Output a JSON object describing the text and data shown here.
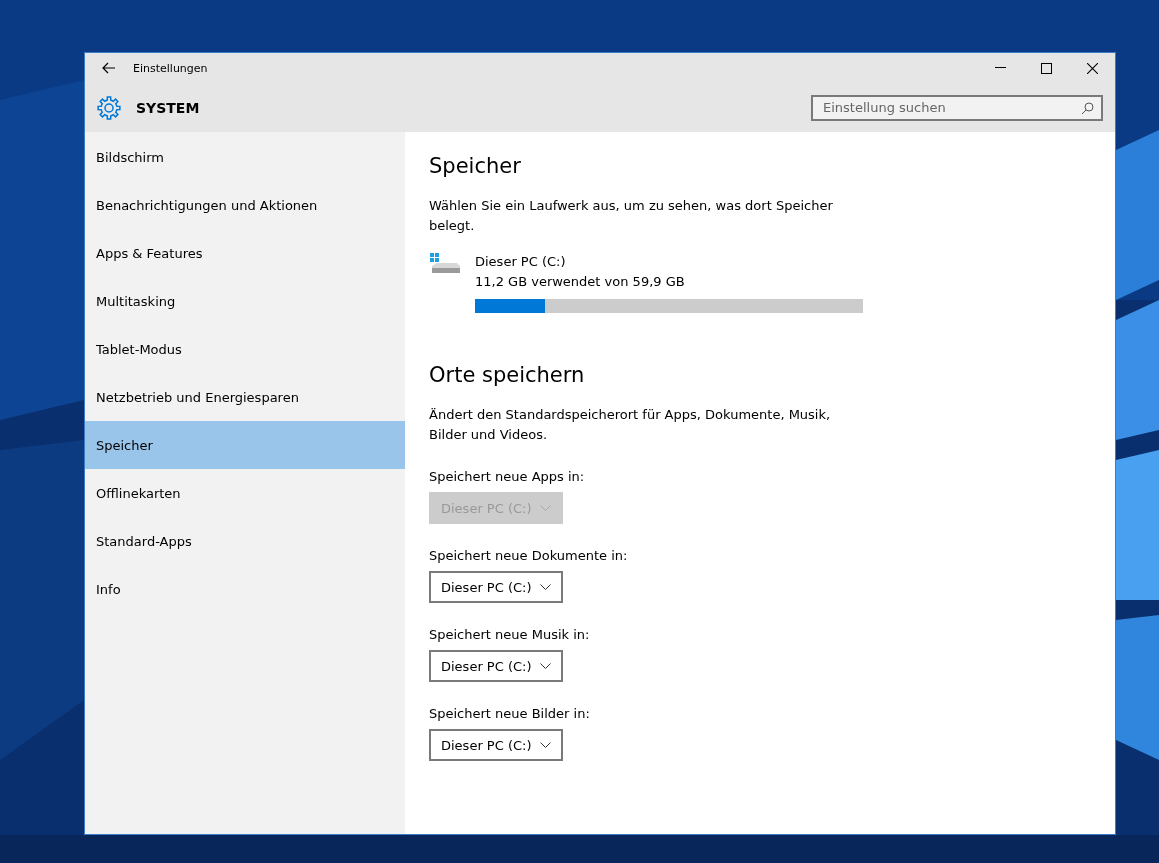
{
  "window": {
    "title": "Einstellungen"
  },
  "header": {
    "title": "SYSTEM",
    "search": {
      "placeholder": "Einstellung suchen"
    }
  },
  "sidebar": {
    "items": [
      {
        "label": "Bildschirm",
        "selected": false
      },
      {
        "label": "Benachrichtigungen und Aktionen",
        "selected": false
      },
      {
        "label": "Apps & Features",
        "selected": false
      },
      {
        "label": "Multitasking",
        "selected": false
      },
      {
        "label": "Tablet-Modus",
        "selected": false
      },
      {
        "label": "Netzbetrieb und Energiesparen",
        "selected": false
      },
      {
        "label": "Speicher",
        "selected": true
      },
      {
        "label": "Offlinekarten",
        "selected": false
      },
      {
        "label": "Standard-Apps",
        "selected": false
      },
      {
        "label": "Info",
        "selected": false
      }
    ]
  },
  "storage": {
    "heading": "Speicher",
    "description": "Wählen Sie ein Laufwerk aus, um zu sehen, was dort Speicher belegt.",
    "drives": [
      {
        "name": "Dieser PC (C:)",
        "usage": "11,2 GB verwendet von 59,9 GB",
        "level": 0.18
      }
    ]
  },
  "save_locations": {
    "heading": "Orte speichern",
    "description": "Ändert den Standardspeicherort für Apps, Dokumente, Musik, Bilder und Videos.",
    "settings": [
      {
        "label": "Speichert neue Apps in:",
        "value": "Dieser PC (C:)",
        "disabled": true
      },
      {
        "label": "Speichert neue Dokumente in:",
        "value": "Dieser PC (C:)",
        "disabled": false
      },
      {
        "label": "Speichert neue Musik in:",
        "value": "Dieser PC (C:)",
        "disabled": false
      },
      {
        "label": "Speichert neue Bilder in:",
        "value": "Dieser PC (C:)",
        "disabled": false
      }
    ]
  }
}
